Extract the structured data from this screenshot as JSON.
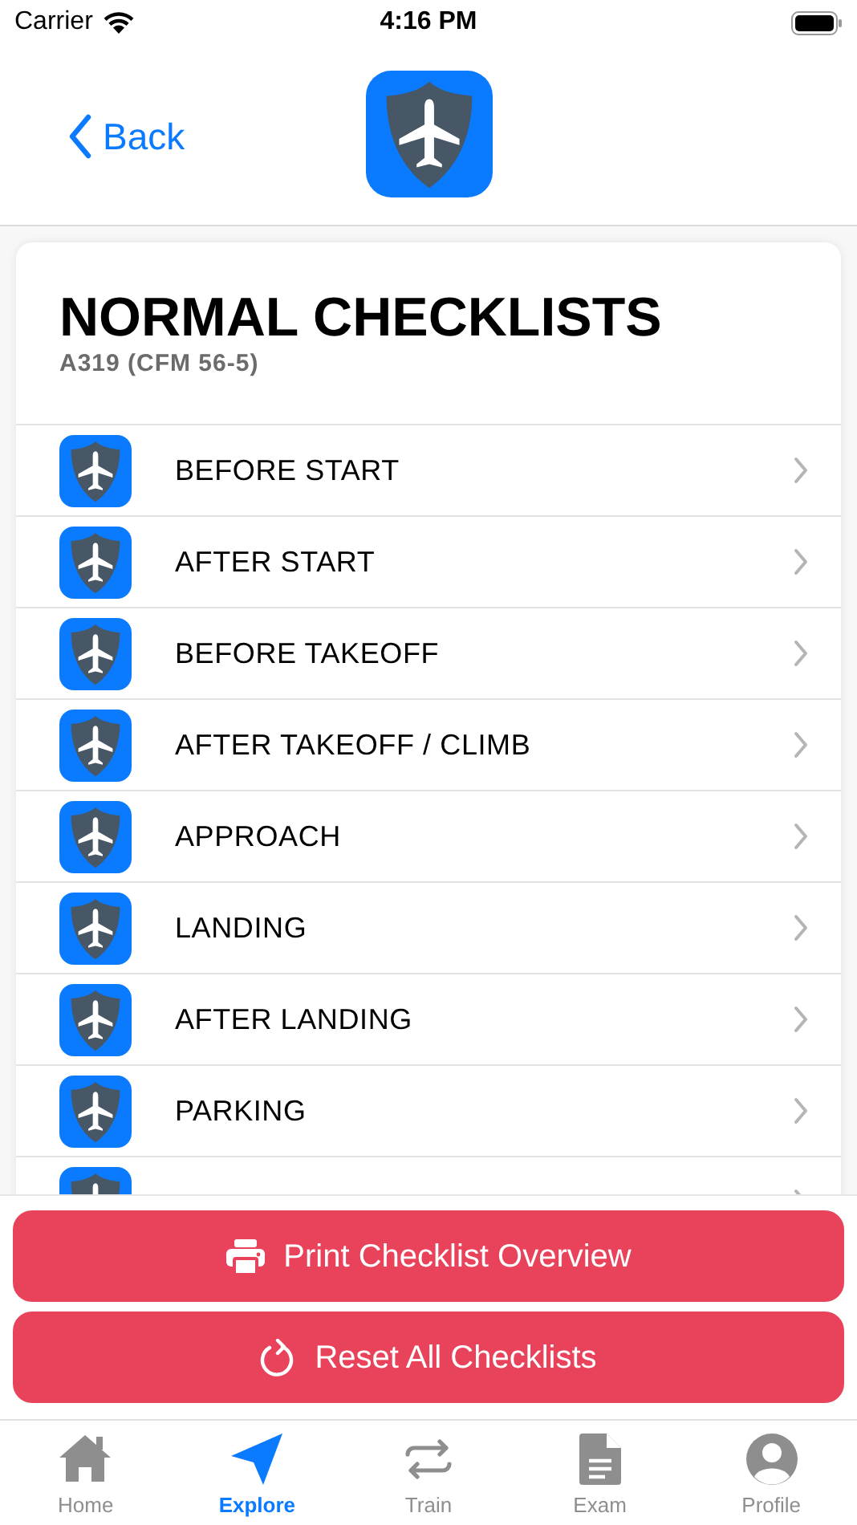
{
  "status_bar": {
    "carrier": "Carrier",
    "time": "4:16 PM"
  },
  "nav": {
    "back": "Back"
  },
  "header": {
    "title": "NORMAL CHECKLISTS",
    "subtitle": "A319 (CFM 56-5)"
  },
  "checklists": [
    {
      "label": "BEFORE START"
    },
    {
      "label": "AFTER START"
    },
    {
      "label": "BEFORE TAKEOFF"
    },
    {
      "label": "AFTER TAKEOFF / CLIMB"
    },
    {
      "label": "APPROACH"
    },
    {
      "label": "LANDING"
    },
    {
      "label": "AFTER LANDING"
    },
    {
      "label": "PARKING"
    }
  ],
  "list_continues": true,
  "actions": [
    {
      "kind": "print",
      "label": "Print Checklist Overview"
    },
    {
      "kind": "reset",
      "label": "Reset All Checklists"
    }
  ],
  "tabs": [
    {
      "kind": "home",
      "label": "Home",
      "selected": false
    },
    {
      "kind": "explore",
      "label": "Explore",
      "selected": true
    },
    {
      "kind": "train",
      "label": "Train",
      "selected": false
    },
    {
      "kind": "exam",
      "label": "Exam",
      "selected": false
    },
    {
      "kind": "profile",
      "label": "Profile",
      "selected": false
    }
  ]
}
